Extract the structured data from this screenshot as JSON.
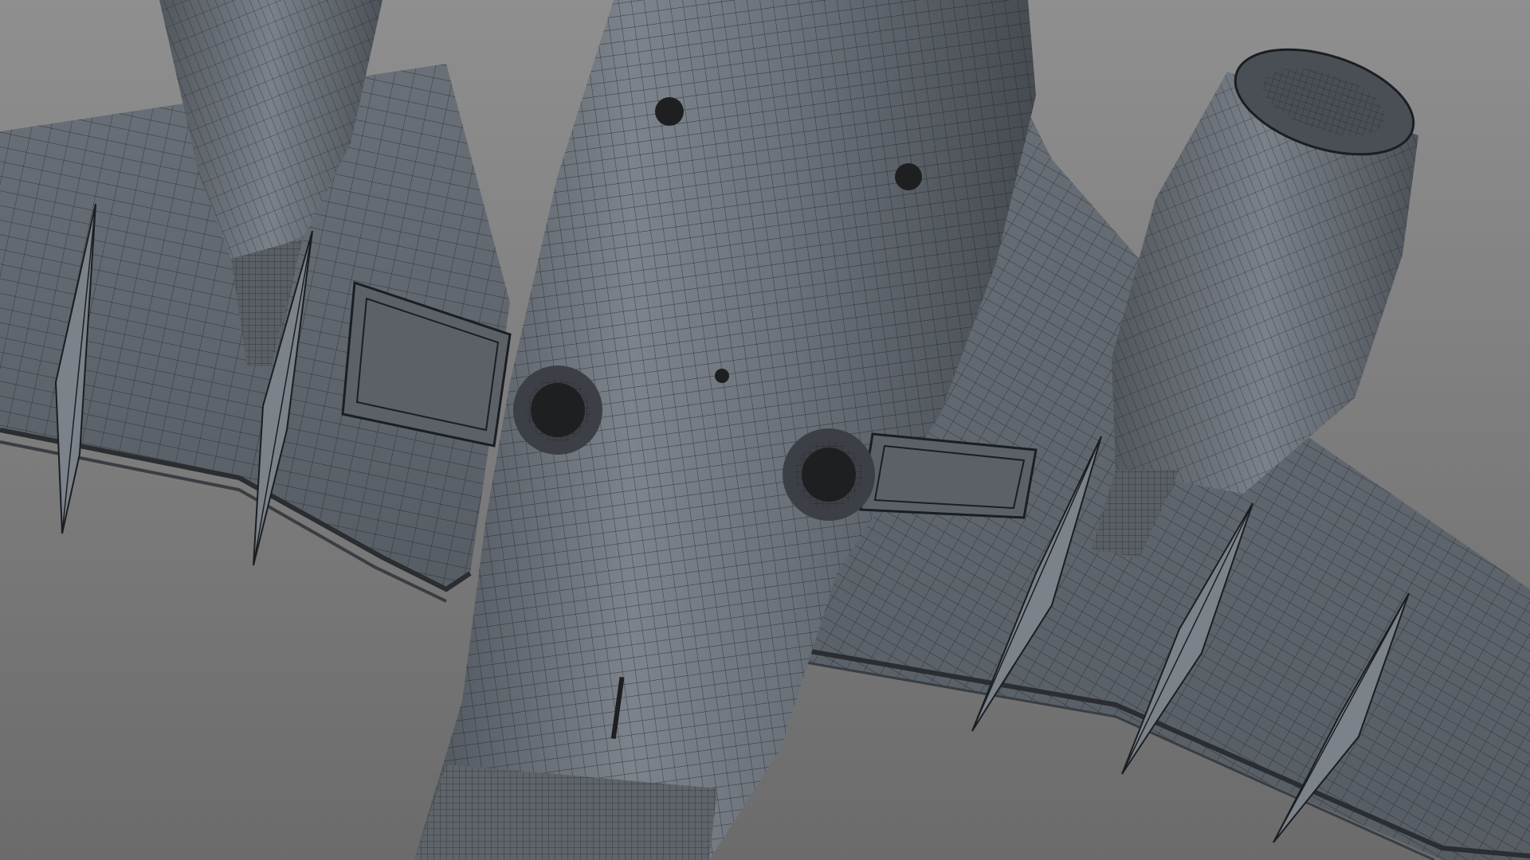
{
  "viewport": {
    "subject": "aircraft-underside-wireframe-mesh",
    "colors": {
      "background_top": "#8d8d8d",
      "background_bottom": "#6e6e6e",
      "surface_light": "#7a8088",
      "surface_mid": "#5e646c",
      "surface_dark": "#474c53",
      "wire": "#1b1e22",
      "hole": "#1e1f21"
    }
  }
}
